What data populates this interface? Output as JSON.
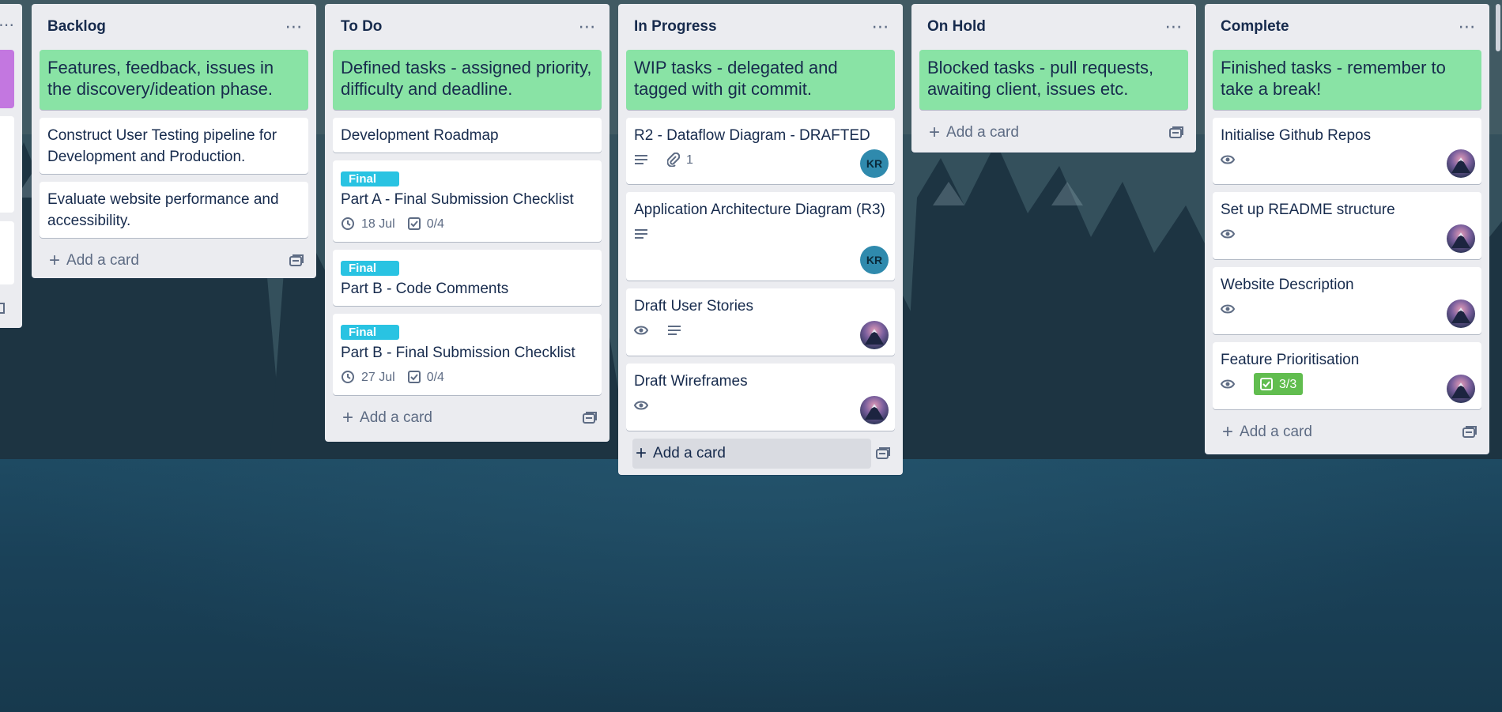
{
  "lists": [
    {
      "title": "Backlog",
      "description": "Features, feedback, issues in the discovery/ideation phase.",
      "cards": [
        {
          "title": "Construct User Testing pipeline for Development and Production."
        },
        {
          "title": "Evaluate website performance and accessibility."
        }
      ],
      "add_label": "Add a card"
    },
    {
      "title": "To Do",
      "description": "Defined tasks - assigned priority, difficulty and deadline.",
      "cards": [
        {
          "title": "Development Roadmap"
        },
        {
          "label": "Final",
          "title": "Part A - Final Submission Checklist",
          "due": "18 Jul",
          "checklist": "0/4"
        },
        {
          "label": "Final",
          "title": "Part B - Code Comments"
        },
        {
          "label": "Final",
          "title": "Part B - Final Submission Checklist",
          "due": "27 Jul",
          "checklist": "0/4"
        }
      ],
      "add_label": "Add a card"
    },
    {
      "title": "In Progress",
      "description": "WIP tasks - delegated and tagged with git commit.",
      "cards": [
        {
          "title": "R2 - Dataflow Diagram - DRAFTED",
          "attachments": "1",
          "member": "KR"
        },
        {
          "title": "Application Architecture Diagram (R3)",
          "member": "KR"
        },
        {
          "title": "Draft User Stories"
        },
        {
          "title": "Draft Wireframes"
        }
      ],
      "add_label": "Add a card"
    },
    {
      "title": "On Hold",
      "description": "Blocked tasks - pull requests, awaiting client, issues etc.",
      "cards": [],
      "add_label": "Add a card"
    },
    {
      "title": "Complete",
      "description": "Finished tasks - remember to take a break!",
      "cards": [
        {
          "title": "Initialise Github Repos"
        },
        {
          "title": "Set up README structure"
        },
        {
          "title": "Website Description"
        },
        {
          "title": "Feature Prioritisation",
          "checklist": "3/3"
        }
      ],
      "add_label": "Add a card"
    }
  ],
  "colors": {
    "list_bg": "#ebecf0",
    "description_card": "#89e3a5",
    "label_final": "#29c3e2",
    "checklist_done": "#61bd4f",
    "partial_list_left": "#c377e0"
  }
}
